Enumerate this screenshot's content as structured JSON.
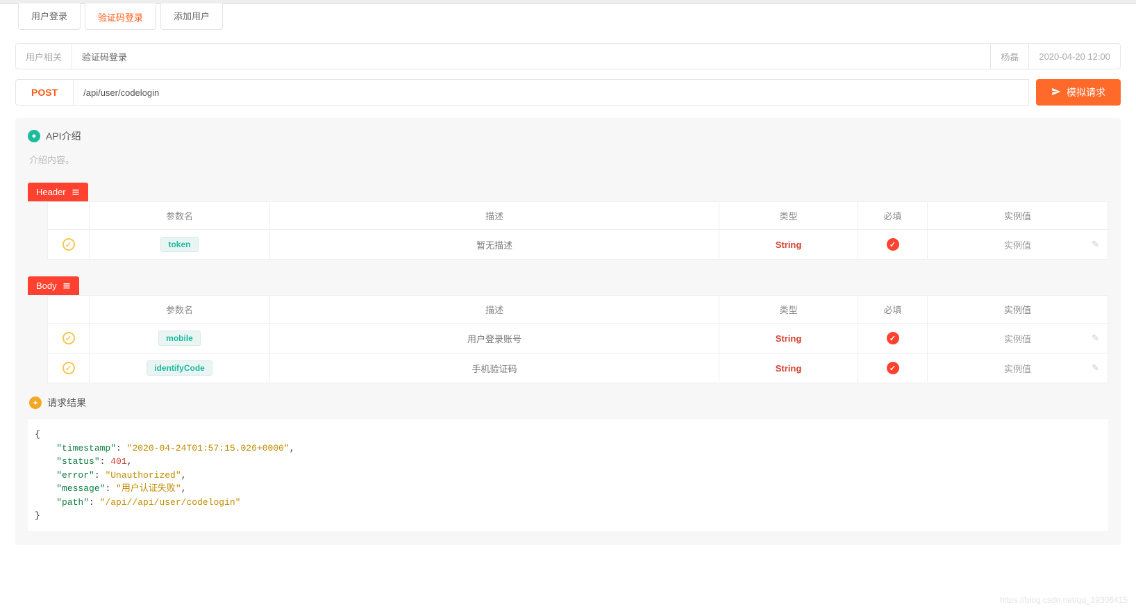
{
  "tabs": [
    {
      "label": "用户登录",
      "active": false
    },
    {
      "label": "验证码登录",
      "active": true
    },
    {
      "label": "添加用户",
      "active": false
    }
  ],
  "meta": {
    "category": "用户相关",
    "title": "验证码登录",
    "author": "杨磊",
    "date": "2020-04-20 12:00"
  },
  "request": {
    "method": "POST",
    "url": "/api/user/codelogin",
    "send_label": "模拟请求"
  },
  "api_intro": {
    "heading": "API介绍",
    "content": "介绍内容。"
  },
  "sections": {
    "header": {
      "tab": "Header",
      "columns": [
        "参数名",
        "描述",
        "类型",
        "必填",
        "实例值"
      ],
      "rows": [
        {
          "name": "token",
          "desc": "暂无描述",
          "desc_empty": true,
          "type": "String",
          "required": true,
          "example": "实例值"
        }
      ]
    },
    "body": {
      "tab": "Body",
      "columns": [
        "参数名",
        "描述",
        "类型",
        "必填",
        "实例值"
      ],
      "rows": [
        {
          "name": "mobile",
          "desc": "用户登录账号",
          "desc_empty": false,
          "type": "String",
          "required": true,
          "example": "实例值"
        },
        {
          "name": "identifyCode",
          "desc": "手机验证码",
          "desc_empty": false,
          "type": "String",
          "required": true,
          "example": "实例值"
        }
      ]
    }
  },
  "result": {
    "heading": "请求结果",
    "json": {
      "timestamp": "2020-04-24T01:57:15.026+0000",
      "status": 401,
      "error": "Unauthorized",
      "message": "用户认证失败",
      "path": "/api//api/user/codelogin"
    }
  },
  "watermark": "https://blog.csdn.net/qq_19306415"
}
